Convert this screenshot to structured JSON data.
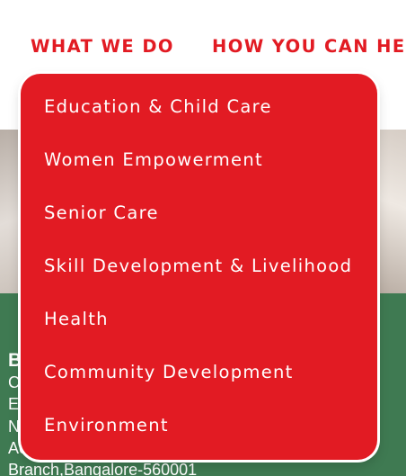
{
  "nav": {
    "items": [
      {
        "label": "WHAT WE DO"
      },
      {
        "label": "HOW YOU CAN HEL"
      }
    ]
  },
  "dropdown": {
    "items": [
      {
        "label": "Education & Child Care"
      },
      {
        "label": "Women Empowerment"
      },
      {
        "label": "Senior Care"
      },
      {
        "label": "Skill Development & Livelihood"
      },
      {
        "label": "Health"
      },
      {
        "label": "Community Development"
      },
      {
        "label": "Environment"
      }
    ]
  },
  "footer": {
    "heading": "B",
    "lines": [
      "C",
      "E",
      "N",
      "Ac",
      "Branch,Bangalore-560001"
    ]
  },
  "colors": {
    "brand_red": "#e21b23",
    "footer_green": "#3f7a52"
  }
}
